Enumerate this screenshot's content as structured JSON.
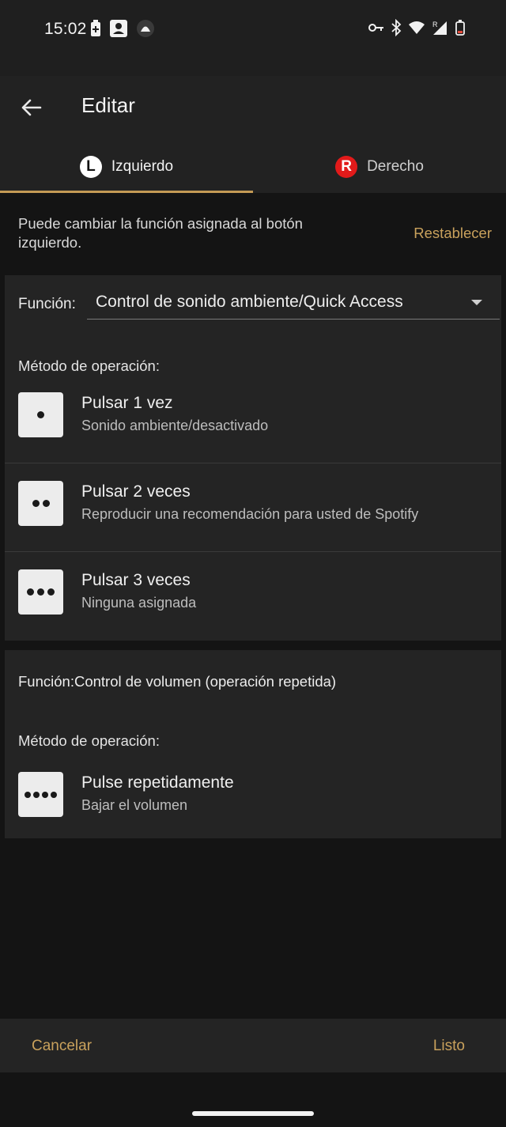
{
  "status_bar": {
    "time": "15:02",
    "left_icons": [
      "battery-saver-icon",
      "contact-card-icon",
      "app-circle-icon"
    ],
    "right_icons": [
      "key-icon",
      "bluetooth-icon",
      "wifi-icon",
      "signal-roaming-icon",
      "battery-icon"
    ]
  },
  "app_bar": {
    "back_icon": "arrow-left-icon",
    "title": "Editar"
  },
  "tabs": [
    {
      "badge": "L",
      "label": "Izquierdo",
      "active": true
    },
    {
      "badge": "R",
      "label": "Derecho",
      "active": false
    }
  ],
  "intro": {
    "text": "Puede cambiar la función asignada al botón izquierdo.",
    "reset_label": "Restablecer"
  },
  "card1": {
    "function_label": "Función:",
    "function_value": "Control de sonido ambiente/Quick Access",
    "method_label": "Método de operación:",
    "operations": [
      {
        "title": "Pulsar 1 vez",
        "subtitle": "Sonido ambiente/desactivado",
        "dots": 1
      },
      {
        "title": "Pulsar 2 veces",
        "subtitle": "Reproducir una recomendación para usted de Spotify",
        "dots": 2
      },
      {
        "title": "Pulsar 3 veces",
        "subtitle": "Ninguna asignada",
        "dots": 3
      }
    ]
  },
  "card2": {
    "function_text": "Función:Control de volumen (operación repetida)",
    "method_label": "Método de operación:",
    "operation": {
      "title": "Pulse repetidamente",
      "subtitle": "Bajar el volumen",
      "dots": 4
    }
  },
  "bottom_bar": {
    "cancel_label": "Cancelar",
    "done_label": "Listo"
  },
  "colors": {
    "accent": "#c49a55",
    "right_badge": "#e21a1a",
    "background": "#141414",
    "surface": "#242424"
  }
}
